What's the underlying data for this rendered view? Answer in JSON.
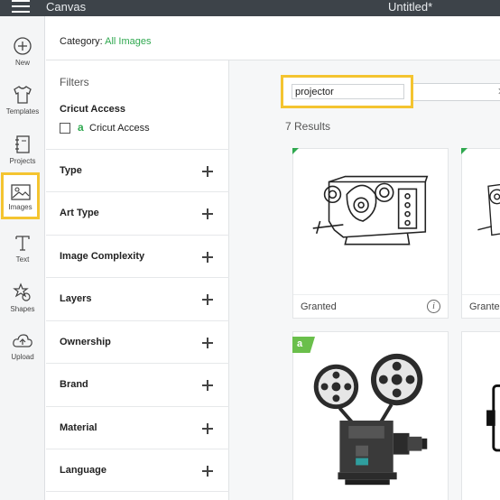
{
  "app": {
    "title": "Canvas",
    "document_title": "Untitled*"
  },
  "rail": {
    "items": [
      {
        "label": "New",
        "icon": "plus-circle-icon"
      },
      {
        "label": "Templates",
        "icon": "tshirt-icon"
      },
      {
        "label": "Projects",
        "icon": "notebook-icon"
      },
      {
        "label": "Images",
        "icon": "image-icon",
        "active": true
      },
      {
        "label": "Text",
        "icon": "text-icon"
      },
      {
        "label": "Shapes",
        "icon": "shapes-icon"
      },
      {
        "label": "Upload",
        "icon": "cloud-upload-icon"
      }
    ]
  },
  "category": {
    "label": "Category:",
    "value": "All Images"
  },
  "filters": {
    "title": "Filters",
    "cricut_access": {
      "heading": "Cricut Access",
      "option_label": "Cricut Access",
      "checked": false
    },
    "groups": [
      {
        "label": "Type"
      },
      {
        "label": "Art Type"
      },
      {
        "label": "Image Complexity"
      },
      {
        "label": "Layers"
      },
      {
        "label": "Ownership"
      },
      {
        "label": "Brand"
      },
      {
        "label": "Material"
      },
      {
        "label": "Language"
      }
    ]
  },
  "search": {
    "value": "projector",
    "placeholder": ""
  },
  "results": {
    "count_text": "7 Results",
    "cards": [
      {
        "status": "Granted"
      },
      {
        "status": "Granted"
      },
      {
        "badge": "a"
      },
      {}
    ]
  },
  "colors": {
    "accent_green": "#2fa84f",
    "highlight_yellow": "#f4c430",
    "topbar": "#3d4349"
  }
}
